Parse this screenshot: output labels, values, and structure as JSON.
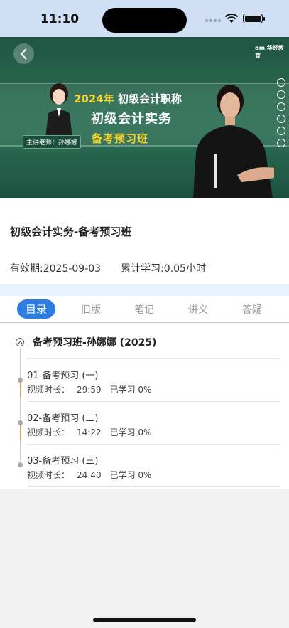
{
  "status_bar": {
    "time": "11:10"
  },
  "video": {
    "logo": "dm 华经教育",
    "banner_year": "2024年",
    "banner_line1_rest": "初级会计职称",
    "banner_line2": "初级会计实务",
    "banner_line3": "备考预习班",
    "teacher_tag": "主讲老师：孙娜娜"
  },
  "course": {
    "title": "初级会计实务-备考预习班",
    "validity": "有效期:2025-09-03",
    "study_total": "累计学习:0.05小时"
  },
  "tabs": [
    {
      "label": "目录",
      "active": true
    },
    {
      "label": "旧版",
      "active": false
    },
    {
      "label": "笔记",
      "active": false
    },
    {
      "label": "讲义",
      "active": false
    },
    {
      "label": "答疑",
      "active": false
    }
  ],
  "catalog": {
    "chapter_title": "备考预习班-孙娜娜 (2025)",
    "lessons": [
      {
        "name": "01-备考预习 (一)",
        "duration_label": "视频时长：",
        "duration": "29:59",
        "progress": "已学习 0%"
      },
      {
        "name": "02-备考预习 (二)",
        "duration_label": "视频时长：",
        "duration": "14:22",
        "progress": "已学习 0%"
      },
      {
        "name": "03-备考预习 (三)",
        "duration_label": "视频时长：",
        "duration": "24:40",
        "progress": "已学习 0%"
      }
    ]
  }
}
